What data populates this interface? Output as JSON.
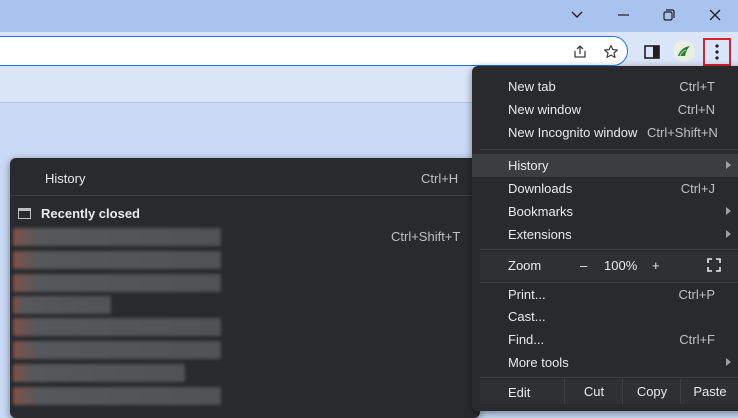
{
  "window_controls": {
    "tab_search_icon": "chevron-down-icon",
    "minimize_icon": "minimize-icon",
    "restore_icon": "restore-icon",
    "close_icon": "close-icon"
  },
  "toolbar": {
    "share_icon": "share-icon",
    "bookmark_icon": "star-icon",
    "sidepanel_icon": "side-panel-icon",
    "menu_icon": "kebab-menu-icon"
  },
  "colors": {
    "accent": "#1a73e8",
    "highlight_border": "#d3242b",
    "menu_bg": "#292a2d"
  },
  "menu": {
    "items": [
      {
        "label": "New tab",
        "shortcut": "Ctrl+T"
      },
      {
        "label": "New window",
        "shortcut": "Ctrl+N"
      },
      {
        "label": "New Incognito window",
        "shortcut": "Ctrl+Shift+N"
      },
      {
        "label": "History",
        "shortcut": ""
      },
      {
        "label": "Downloads",
        "shortcut": "Ctrl+J"
      },
      {
        "label": "Bookmarks",
        "shortcut": ""
      },
      {
        "label": "Extensions",
        "shortcut": ""
      },
      {
        "label": "Print...",
        "shortcut": "Ctrl+P"
      },
      {
        "label": "Cast...",
        "shortcut": ""
      },
      {
        "label": "Find...",
        "shortcut": "Ctrl+F"
      },
      {
        "label": "More tools",
        "shortcut": ""
      }
    ],
    "zoom": {
      "label": "Zoom",
      "minus": "–",
      "value": "100%",
      "plus": "+"
    },
    "edit": {
      "label": "Edit",
      "cut": "Cut",
      "copy": "Copy",
      "paste": "Paste"
    }
  },
  "history_submenu": {
    "history": {
      "label": "History",
      "shortcut": "Ctrl+H"
    },
    "recently_closed": {
      "label": "Recently closed",
      "shortcut": "Ctrl+Shift+T"
    }
  }
}
